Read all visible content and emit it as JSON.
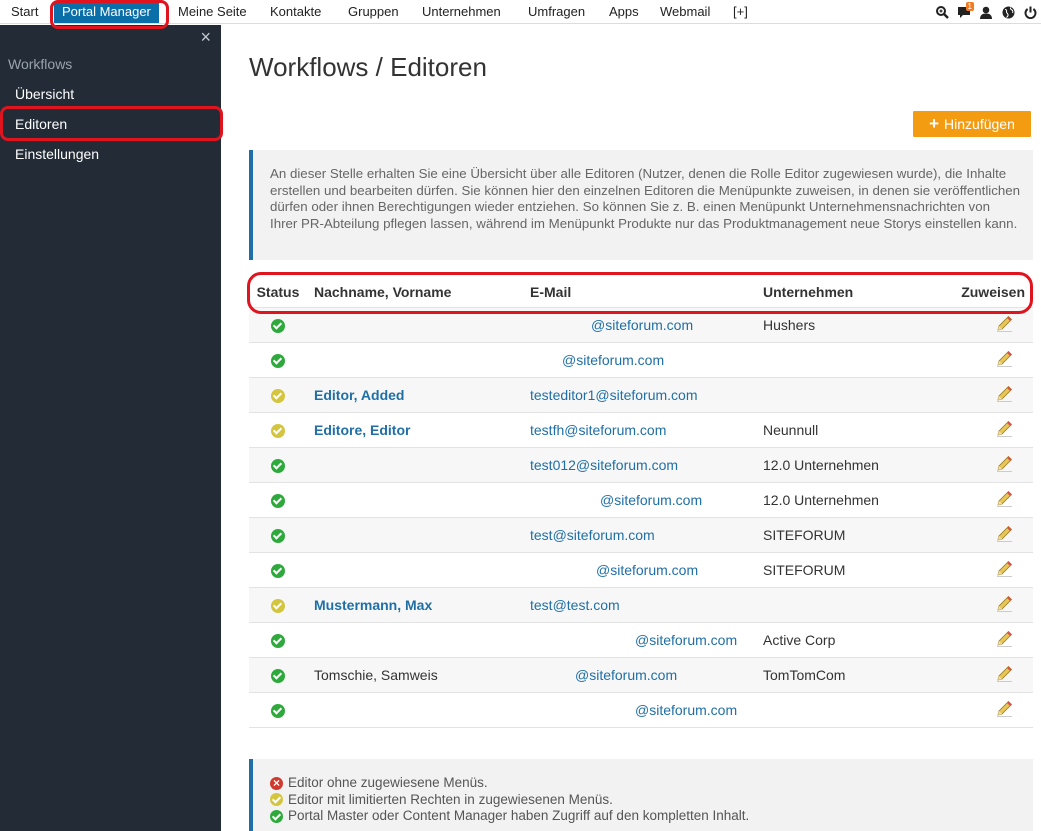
{
  "topnav": {
    "items": [
      "Start",
      "Portal Manager",
      "Meine Seite",
      "Kontakte",
      "Gruppen",
      "Unternehmen",
      "Umfragen",
      "Apps",
      "Webmail",
      "[+]"
    ],
    "notification_count": "1"
  },
  "sidebar": {
    "close": "×",
    "heading": "Workflows",
    "items": [
      "Übersicht",
      "Editoren",
      "Einstellungen"
    ]
  },
  "page": {
    "title": "Workflows / Editoren",
    "add_button": "Hinzufügen",
    "add_button_icon": "+",
    "info_text": "An dieser Stelle erhalten Sie eine Übersicht über alle Editoren (Nutzer, denen die Rolle Editor zugewiesen wurde), die Inhalte erstellen und bearbeiten dürfen. Sie können hier den einzelnen Editoren die Menüpunkte zuweisen, in denen sie veröffentlichen dürfen oder ihnen Berechtigungen wieder entziehen. So können Sie z. B. einen Menüpunkt Unternehmensnachrichten von Ihrer PR-Abteilung pflegen lassen, während im Menüpunkt Produkte nur das Produktmanagement neue Storys einstellen kann."
  },
  "table": {
    "headers": [
      "Status",
      "Nachname, Vorname",
      "E-Mail",
      "Unternehmen",
      "Zuweisen"
    ],
    "rows": [
      {
        "status": "green",
        "name": "",
        "email": "@siteforum.com",
        "company": "Hushers"
      },
      {
        "status": "green",
        "name": "",
        "email": "@siteforum.com",
        "company": ""
      },
      {
        "status": "yellow",
        "name": "Editor, Added",
        "email": "testeditor1@siteforum.com",
        "company": ""
      },
      {
        "status": "yellow",
        "name": "Editore, Editor",
        "email": "testfh@siteforum.com",
        "company": "Neunnull"
      },
      {
        "status": "green",
        "name": "",
        "email": "test012@siteforum.com",
        "company": "12.0 Unternehmen"
      },
      {
        "status": "green",
        "name": "",
        "email": "@siteforum.com",
        "company": "12.0 Unternehmen"
      },
      {
        "status": "green",
        "name": "",
        "email": "test@siteforum.com",
        "company": "SITEFORUM"
      },
      {
        "status": "green",
        "name": "",
        "email": "@siteforum.com",
        "company": "SITEFORUM"
      },
      {
        "status": "yellow",
        "name": "Mustermann, Max",
        "email": "test@test.com",
        "company": ""
      },
      {
        "status": "green",
        "name": "",
        "email": "@siteforum.com",
        "company": "Active Corp"
      },
      {
        "status": "green",
        "name": "Tomschie, Samweis",
        "email": "@siteforum.com",
        "company": "TomTomCom"
      },
      {
        "status": "green",
        "name": "",
        "email": "@siteforum.com",
        "company": ""
      }
    ]
  },
  "legend": [
    {
      "status": "red",
      "text": "Editor ohne zugewiesene Menüs."
    },
    {
      "status": "yellow",
      "text": "Editor mit limitierten Rechten in zugewiesenen Menüs."
    },
    {
      "status": "green",
      "text": "Portal Master oder Content Manager haben Zugriff auf den kompletten Inhalt."
    }
  ],
  "colors": {
    "accent_blue": "#1f6fa6",
    "orange": "#f39c12",
    "sidebar_bg": "#222b36",
    "status_green": "#2eaa3c",
    "status_yellow": "#d4c53e",
    "status_red": "#d0392b"
  }
}
